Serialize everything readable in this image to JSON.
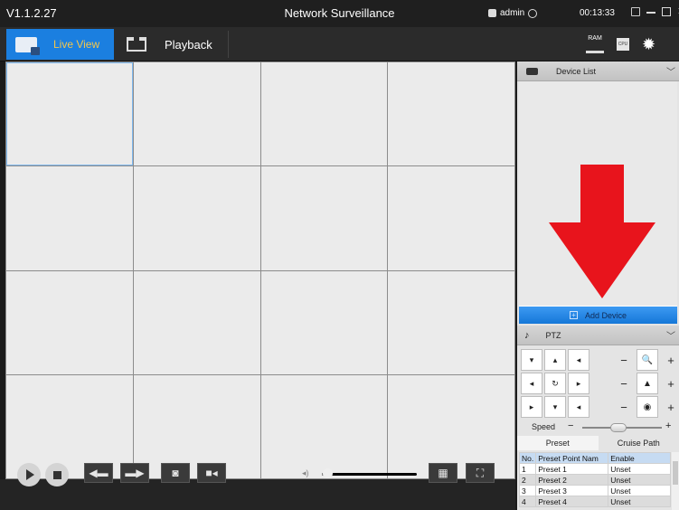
{
  "titlebar": {
    "version": "V1.1.2.27",
    "title": "Network Surveillance",
    "user": "admin",
    "clock": "00:13:33"
  },
  "toolbar": {
    "live_view_label": "Live View",
    "playback_label": "Playback",
    "ram_label": "RAM",
    "cpu_label": "CPU"
  },
  "grid": {
    "rows": 4,
    "cols": 4,
    "active_cell": 0
  },
  "bottombar": {
    "volume_level": 0.05
  },
  "device_list": {
    "title": "Device List",
    "add_device_label": "Add Device"
  },
  "ptz": {
    "title": "PTZ",
    "direction_buttons": [
      "▾",
      "▴",
      "◂",
      "◂",
      "↻",
      "▸",
      "▸",
      "▾",
      "◂"
    ],
    "zoom_rows": [
      {
        "minus": "−",
        "icon": "magnifier-icon",
        "plus": "+"
      },
      {
        "minus": "−",
        "icon": "focus-icon",
        "plus": "+"
      },
      {
        "minus": "−",
        "icon": "iris-icon",
        "plus": "+"
      }
    ],
    "speed_label": "Speed",
    "speed_minus": "−",
    "speed_plus": "+",
    "speed_level": 0.45,
    "tabs": [
      "Preset",
      "Cruise Path"
    ],
    "table": {
      "headers": [
        "No.",
        "Preset Point Nam",
        "Enable"
      ],
      "rows": [
        [
          "1",
          "Preset 1",
          "Unset"
        ],
        [
          "2",
          "Preset 2",
          "Unset"
        ],
        [
          "3",
          "Preset 3",
          "Unset"
        ],
        [
          "4",
          "Preset 4",
          "Unset"
        ]
      ]
    }
  },
  "colors": {
    "accent_blue": "#1b7fe0",
    "live_view_text": "#f4c64b",
    "arrow_red": "#e8141c",
    "panel_bg": "#e4e4e4"
  }
}
